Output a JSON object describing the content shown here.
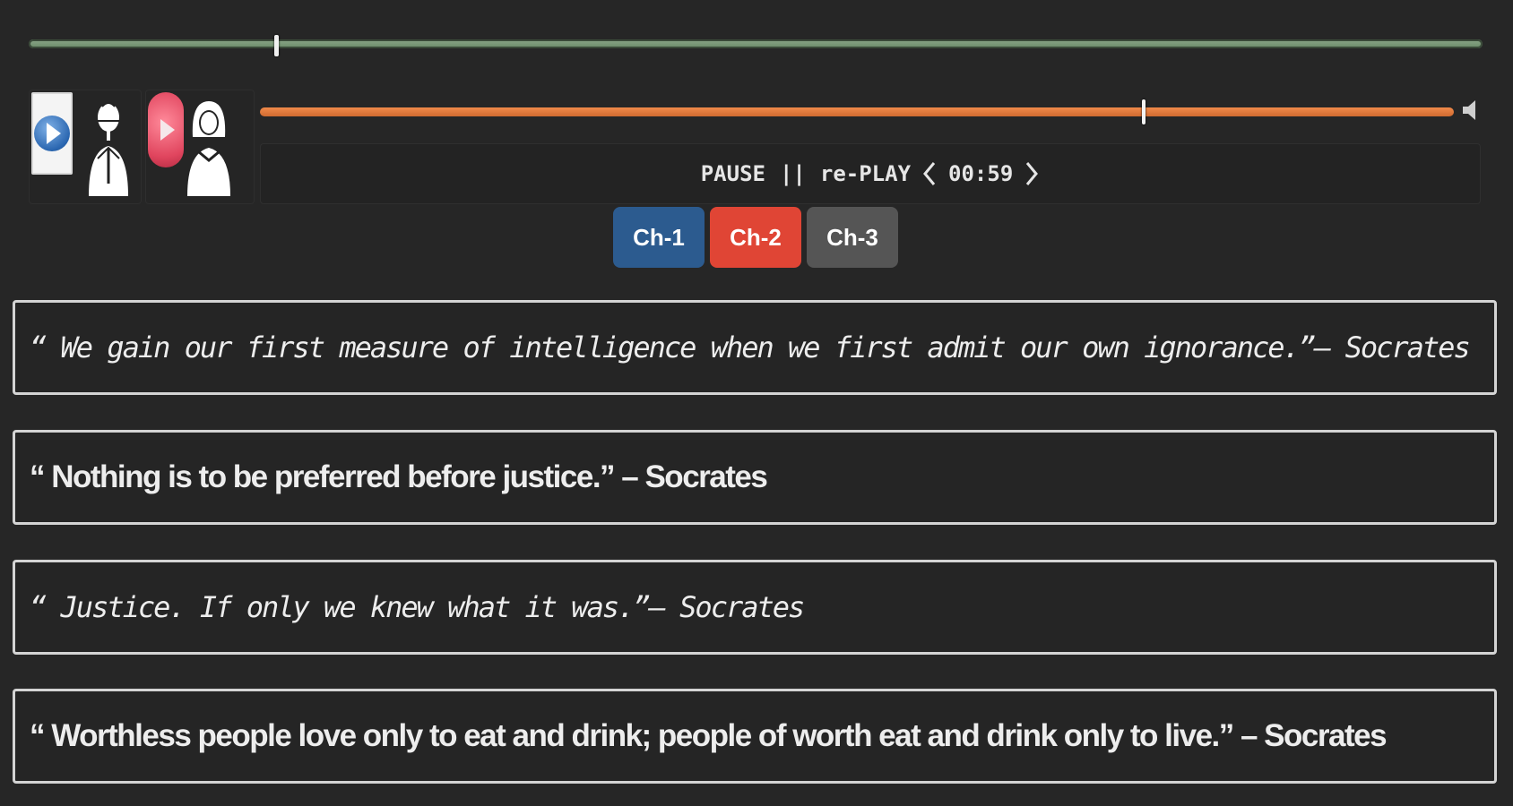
{
  "player": {
    "seek_progress": 0.17,
    "audio_progress": 0.74
  },
  "speakers": [
    {
      "name": "male",
      "play_color": "#2a66b0"
    },
    {
      "name": "female",
      "play_color": "#e0455e"
    }
  ],
  "controls": {
    "pause_label": "PAUSE",
    "separator": "||",
    "replay_label": "re-PLAY",
    "time": "00:59"
  },
  "channels": [
    {
      "label": "Ch-1",
      "color": "#2c5b8f"
    },
    {
      "label": "Ch-2",
      "color": "#e04535"
    },
    {
      "label": "Ch-3",
      "color": "#555555"
    }
  ],
  "quotes": [
    {
      "text": "“ We gain our first measure of intelligence when we first admit our own ignorance.”– Socrates"
    },
    {
      "text": "“ Nothing is to be preferred before justice.” – Socrates"
    },
    {
      "text": "“ Justice. If only we knew what it was.”– Socrates"
    },
    {
      "text": "“ Worthless people love only to eat and drink; people of worth eat and drink only to live.” – Socrates"
    }
  ]
}
